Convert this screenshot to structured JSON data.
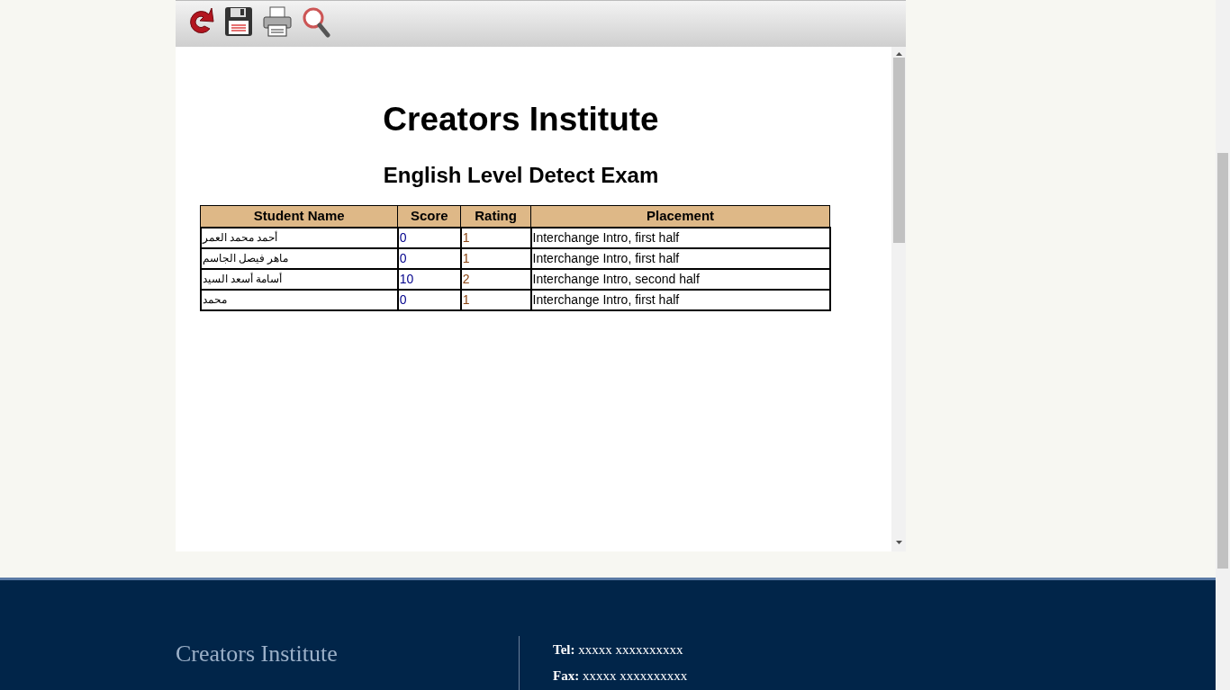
{
  "toolbar": {
    "buttons": [
      {
        "kind": "refresh"
      },
      {
        "kind": "save"
      },
      {
        "kind": "print"
      },
      {
        "kind": "find"
      }
    ]
  },
  "report": {
    "title": "Creators Institute",
    "subtitle": "English Level Detect Exam",
    "table": {
      "columns": [
        "Student Name",
        "Score",
        "Rating",
        "Placement"
      ],
      "rows": [
        [
          "أحمد محمد العمر",
          "0",
          "1",
          "Interchange Intro, first half"
        ],
        [
          "ماهر فيصل الجاسم",
          "0",
          "1",
          "Interchange Intro, first half"
        ],
        [
          "أسامة أسعد السيد",
          "10",
          "2",
          "Interchange Intro, second half"
        ],
        [
          "محمد",
          "0",
          "1",
          "Interchange Intro, first half"
        ]
      ]
    }
  },
  "footer": {
    "name": "Creators Institute",
    "contacts": [
      "**Tel:** xxxxx xxxxxxxxxx",
      "**Fax:** xxxxx xxxxxxxxxx"
    ]
  }
}
